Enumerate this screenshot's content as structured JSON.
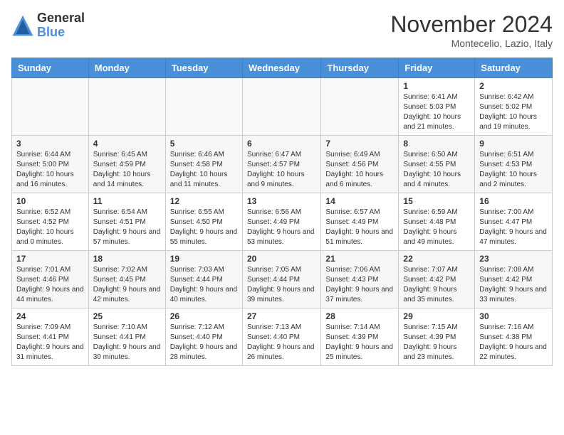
{
  "logo": {
    "general": "General",
    "blue": "Blue"
  },
  "title": "November 2024",
  "location": "Montecelio, Lazio, Italy",
  "weekdays": [
    "Sunday",
    "Monday",
    "Tuesday",
    "Wednesday",
    "Thursday",
    "Friday",
    "Saturday"
  ],
  "weeks": [
    [
      {
        "day": "",
        "info": ""
      },
      {
        "day": "",
        "info": ""
      },
      {
        "day": "",
        "info": ""
      },
      {
        "day": "",
        "info": ""
      },
      {
        "day": "",
        "info": ""
      },
      {
        "day": "1",
        "info": "Sunrise: 6:41 AM\nSunset: 5:03 PM\nDaylight: 10 hours and 21 minutes."
      },
      {
        "day": "2",
        "info": "Sunrise: 6:42 AM\nSunset: 5:02 PM\nDaylight: 10 hours and 19 minutes."
      }
    ],
    [
      {
        "day": "3",
        "info": "Sunrise: 6:44 AM\nSunset: 5:00 PM\nDaylight: 10 hours and 16 minutes."
      },
      {
        "day": "4",
        "info": "Sunrise: 6:45 AM\nSunset: 4:59 PM\nDaylight: 10 hours and 14 minutes."
      },
      {
        "day": "5",
        "info": "Sunrise: 6:46 AM\nSunset: 4:58 PM\nDaylight: 10 hours and 11 minutes."
      },
      {
        "day": "6",
        "info": "Sunrise: 6:47 AM\nSunset: 4:57 PM\nDaylight: 10 hours and 9 minutes."
      },
      {
        "day": "7",
        "info": "Sunrise: 6:49 AM\nSunset: 4:56 PM\nDaylight: 10 hours and 6 minutes."
      },
      {
        "day": "8",
        "info": "Sunrise: 6:50 AM\nSunset: 4:55 PM\nDaylight: 10 hours and 4 minutes."
      },
      {
        "day": "9",
        "info": "Sunrise: 6:51 AM\nSunset: 4:53 PM\nDaylight: 10 hours and 2 minutes."
      }
    ],
    [
      {
        "day": "10",
        "info": "Sunrise: 6:52 AM\nSunset: 4:52 PM\nDaylight: 10 hours and 0 minutes."
      },
      {
        "day": "11",
        "info": "Sunrise: 6:54 AM\nSunset: 4:51 PM\nDaylight: 9 hours and 57 minutes."
      },
      {
        "day": "12",
        "info": "Sunrise: 6:55 AM\nSunset: 4:50 PM\nDaylight: 9 hours and 55 minutes."
      },
      {
        "day": "13",
        "info": "Sunrise: 6:56 AM\nSunset: 4:49 PM\nDaylight: 9 hours and 53 minutes."
      },
      {
        "day": "14",
        "info": "Sunrise: 6:57 AM\nSunset: 4:49 PM\nDaylight: 9 hours and 51 minutes."
      },
      {
        "day": "15",
        "info": "Sunrise: 6:59 AM\nSunset: 4:48 PM\nDaylight: 9 hours and 49 minutes."
      },
      {
        "day": "16",
        "info": "Sunrise: 7:00 AM\nSunset: 4:47 PM\nDaylight: 9 hours and 47 minutes."
      }
    ],
    [
      {
        "day": "17",
        "info": "Sunrise: 7:01 AM\nSunset: 4:46 PM\nDaylight: 9 hours and 44 minutes."
      },
      {
        "day": "18",
        "info": "Sunrise: 7:02 AM\nSunset: 4:45 PM\nDaylight: 9 hours and 42 minutes."
      },
      {
        "day": "19",
        "info": "Sunrise: 7:03 AM\nSunset: 4:44 PM\nDaylight: 9 hours and 40 minutes."
      },
      {
        "day": "20",
        "info": "Sunrise: 7:05 AM\nSunset: 4:44 PM\nDaylight: 9 hours and 39 minutes."
      },
      {
        "day": "21",
        "info": "Sunrise: 7:06 AM\nSunset: 4:43 PM\nDaylight: 9 hours and 37 minutes."
      },
      {
        "day": "22",
        "info": "Sunrise: 7:07 AM\nSunset: 4:42 PM\nDaylight: 9 hours and 35 minutes."
      },
      {
        "day": "23",
        "info": "Sunrise: 7:08 AM\nSunset: 4:42 PM\nDaylight: 9 hours and 33 minutes."
      }
    ],
    [
      {
        "day": "24",
        "info": "Sunrise: 7:09 AM\nSunset: 4:41 PM\nDaylight: 9 hours and 31 minutes."
      },
      {
        "day": "25",
        "info": "Sunrise: 7:10 AM\nSunset: 4:41 PM\nDaylight: 9 hours and 30 minutes."
      },
      {
        "day": "26",
        "info": "Sunrise: 7:12 AM\nSunset: 4:40 PM\nDaylight: 9 hours and 28 minutes."
      },
      {
        "day": "27",
        "info": "Sunrise: 7:13 AM\nSunset: 4:40 PM\nDaylight: 9 hours and 26 minutes."
      },
      {
        "day": "28",
        "info": "Sunrise: 7:14 AM\nSunset: 4:39 PM\nDaylight: 9 hours and 25 minutes."
      },
      {
        "day": "29",
        "info": "Sunrise: 7:15 AM\nSunset: 4:39 PM\nDaylight: 9 hours and 23 minutes."
      },
      {
        "day": "30",
        "info": "Sunrise: 7:16 AM\nSunset: 4:38 PM\nDaylight: 9 hours and 22 minutes."
      }
    ]
  ]
}
